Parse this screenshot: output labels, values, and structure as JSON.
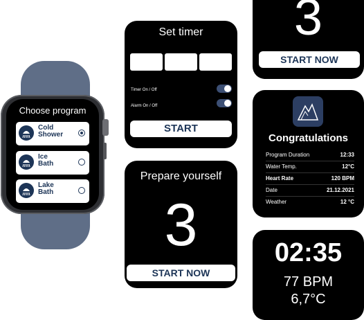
{
  "program": {
    "title": "Choose program",
    "items": [
      {
        "label": "Cold\nShower",
        "selected": true
      },
      {
        "label": "Ice\nBath",
        "selected": false
      },
      {
        "label": "Lake\nBath",
        "selected": false
      }
    ]
  },
  "timer": {
    "title": "Set timer",
    "timer_label": "Timer On / Off",
    "alarm_label": "Alarm On / Off",
    "start_label": "START"
  },
  "countdown_top": {
    "number": "3",
    "button": "START NOW"
  },
  "prepare": {
    "title": "Prepare yourself",
    "number": "3",
    "button": "START NOW"
  },
  "congrats": {
    "title": "Congratulations",
    "rows": [
      {
        "key": "Program Duration",
        "value": "12:33"
      },
      {
        "key": "Water Temp.",
        "value": "12°C"
      },
      {
        "key": "Heart Rate",
        "value": "120 BPM"
      },
      {
        "key": "Date",
        "value": "21.12.2021"
      },
      {
        "key": "Weather",
        "value": "12 °C"
      }
    ]
  },
  "live": {
    "time": "02:35",
    "bpm": "77 BPM",
    "temp": "6,7°C"
  },
  "colors": {
    "accent": "#1d3557",
    "band": "#5f6e87"
  }
}
